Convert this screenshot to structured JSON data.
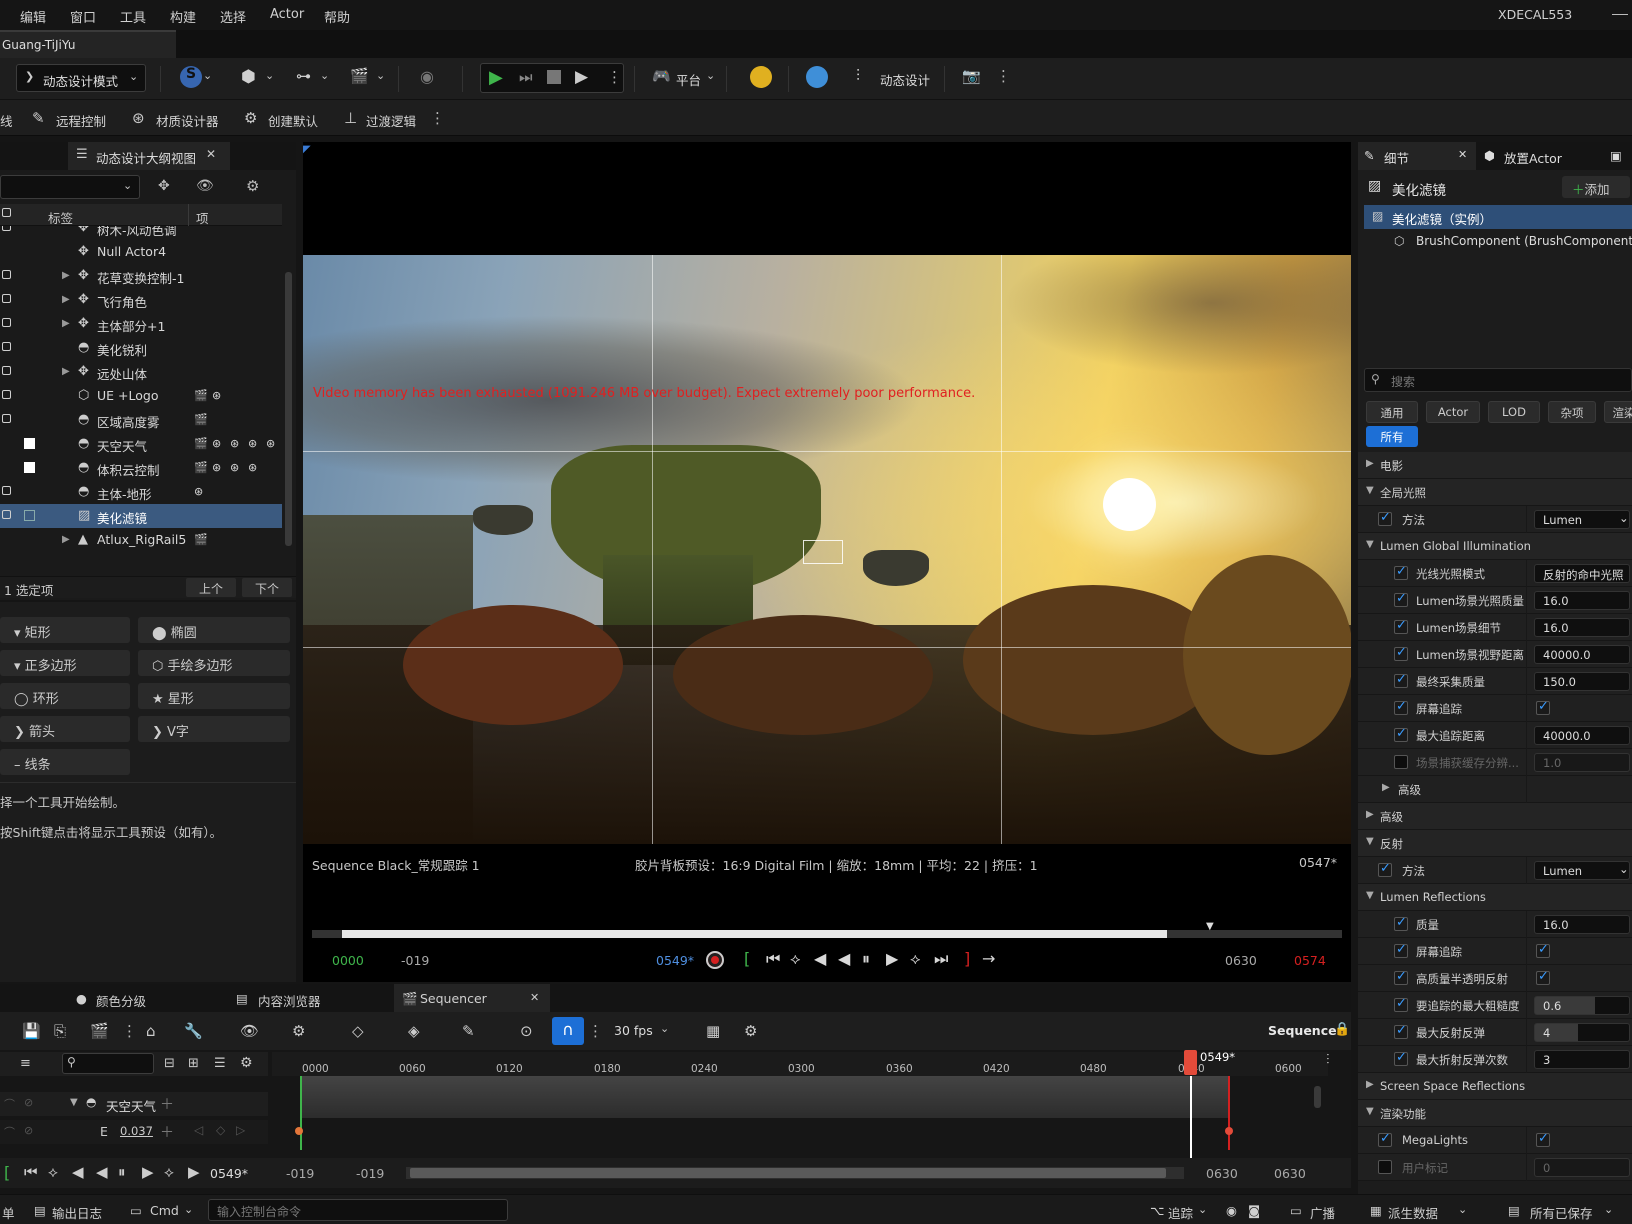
{
  "menu": {
    "items": [
      "编辑",
      "窗口",
      "工具",
      "构建",
      "选择",
      "Actor",
      "帮助"
    ],
    "project": "XDECAL553"
  },
  "map_tab": "Guang-TiJiYu",
  "toolbar": {
    "mode": "动态设计模式",
    "platform": "平台",
    "motion_design": "动态设计"
  },
  "toolbar2": {
    "items": [
      "线",
      "远程控制",
      "材质设计器",
      "创建默认",
      "过渡逻辑"
    ]
  },
  "outliner": {
    "tab": "动态设计大纲视图",
    "col_label": "标签",
    "col_item": "项",
    "rows": [
      {
        "name": "树木-风动色调"
      },
      {
        "name": "Null Actor4"
      },
      {
        "name": "花草变换控制-1"
      },
      {
        "name": "飞行角色"
      },
      {
        "name": "主体部分+1"
      },
      {
        "name": "美化锐利"
      },
      {
        "name": "远处山体"
      },
      {
        "name": "UE +Logo"
      },
      {
        "name": "区域高度雾"
      },
      {
        "name": "天空天气"
      },
      {
        "name": "体积云控制"
      },
      {
        "name": "主体-地形"
      },
      {
        "name": "美化滤镜"
      },
      {
        "name": "Atlux_RigRail5"
      }
    ],
    "footer": {
      "count": "1 选定项",
      "prev": "上个",
      "next": "下个"
    }
  },
  "shapes": {
    "items": [
      "矩形",
      "椭圆",
      "正多边形",
      "手绘多边形",
      "环形",
      "星形",
      "箭头",
      "V字",
      "线条"
    ],
    "hint1": "择一个工具开始绘制。",
    "hint2": "按Shift键点击将显示工具预设（如有）。"
  },
  "viewport": {
    "warning": "Video memory has been exhausted (1091.246 MB over budget). Expect extremely poor performance.",
    "sequence": "Sequence Black_常规跟踪 1",
    "filmback": "胶片背板预设：16:9 Digital Film | 缩放：18mm | 平均：22 | 挤压：1",
    "frame_right": "0547*",
    "start": "0000",
    "in": "-019",
    "current": "0549*",
    "out": "0630",
    "end": "0574",
    "progress": 0.85
  },
  "details": {
    "tab1": "细节",
    "tab2": "放置Actor",
    "actor_title": "美化滤镜",
    "add": "添加",
    "instance": "美化滤镜（实例）",
    "component": "BrushComponent (BrushComponent0)",
    "search_placeholder": "搜索",
    "categories": [
      "通用",
      "Actor",
      "LOD",
      "杂项",
      "渲染"
    ],
    "all": "所有",
    "props": [
      {
        "label": "电影",
        "value": ""
      },
      {
        "label": "全局光照",
        "value": ""
      },
      {
        "label": "方法",
        "value": "Lumen"
      },
      {
        "label": "Lumen Global Illumination",
        "value": ""
      },
      {
        "label": "光线光照模式",
        "value": "反射的命中光照"
      },
      {
        "label": "Lumen场景光照质量",
        "value": "16.0"
      },
      {
        "label": "Lumen场景细节",
        "value": "16.0"
      },
      {
        "label": "Lumen场景视野距离",
        "value": "40000.0"
      },
      {
        "label": "最终采集质量",
        "value": "150.0"
      },
      {
        "label": "屏幕追踪",
        "value": ""
      },
      {
        "label": "最大追踪距离",
        "value": "40000.0"
      },
      {
        "label": "场景捕获缓存分辨...",
        "value": "1.0"
      },
      {
        "label": "高级",
        "value": ""
      },
      {
        "label": "高级",
        "value": ""
      },
      {
        "label": "反射",
        "value": ""
      },
      {
        "label": "方法",
        "value": "Lumen"
      },
      {
        "label": "Lumen Reflections",
        "value": ""
      },
      {
        "label": "质量",
        "value": "16.0"
      },
      {
        "label": "屏幕追踪",
        "value": ""
      },
      {
        "label": "高质量半透明反射",
        "value": ""
      },
      {
        "label": "要追踪的最大粗糙度",
        "value": "0.6"
      },
      {
        "label": "最大反射反弹",
        "value": "4"
      },
      {
        "label": "最大折射反弹次数",
        "value": "3"
      },
      {
        "label": "Screen Space Reflections",
        "value": ""
      },
      {
        "label": "渲染功能",
        "value": ""
      },
      {
        "label": "MegaLights",
        "value": ""
      },
      {
        "label": "用户标记",
        "value": "0"
      }
    ]
  },
  "bottom": {
    "tabs": [
      "颜色分级",
      "内容浏览器",
      "Sequencer"
    ],
    "fps": "30 fps",
    "sequence_label": "Sequence",
    "ticks": [
      "0000",
      "0060",
      "0120",
      "0180",
      "0240",
      "0300",
      "0360",
      "0420",
      "0480",
      "0540",
      "0600"
    ],
    "playhead": "0549*",
    "track1": "天空天气",
    "track2": "E",
    "track2_value": "0.037",
    "current": "0549*",
    "r1": "-019",
    "r2": "-019",
    "r3": "0630",
    "r4": "0630"
  },
  "status": {
    "left": "单",
    "log": "输出日志",
    "cmd": "Cmd",
    "console_placeholder": "输入控制台命令",
    "trace": "追踪",
    "broadcast": "广播",
    "derived": "派生数据",
    "saved": "所有已保存"
  }
}
